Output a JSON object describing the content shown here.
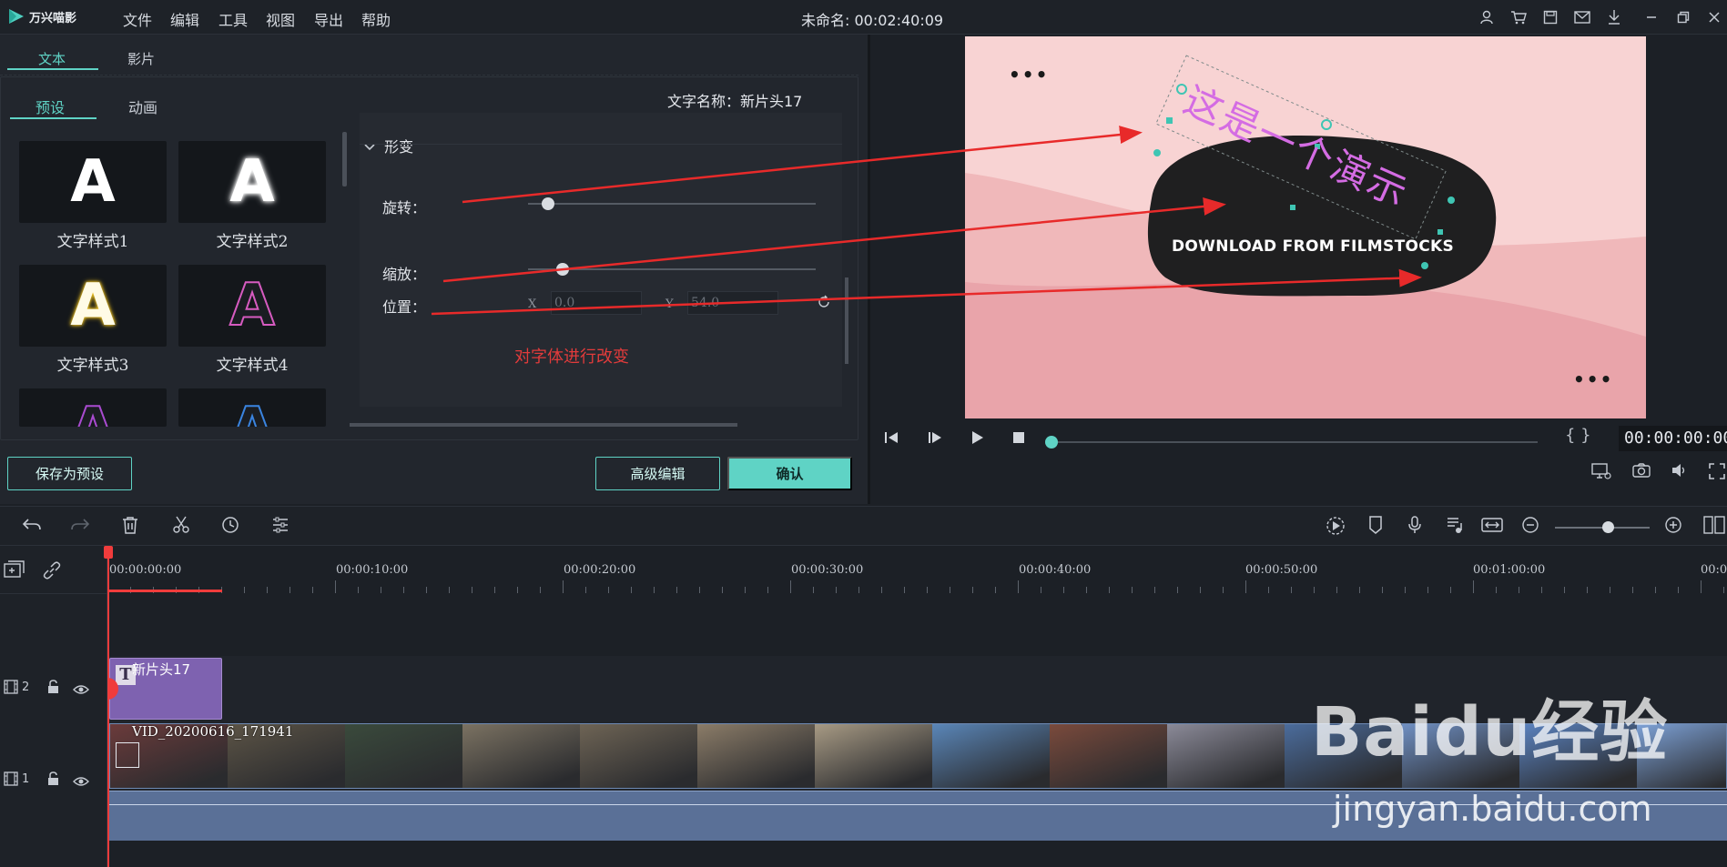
{
  "app": {
    "name": "万兴喵影",
    "document_title": "未命名: 00:02:40:09",
    "menu": [
      "文件",
      "编辑",
      "工具",
      "视图",
      "导出",
      "帮助"
    ],
    "window_icons": [
      "user-icon",
      "cart-icon",
      "save-icon",
      "mail-icon",
      "download-icon",
      "minimize-icon",
      "restore-icon",
      "close-icon"
    ]
  },
  "panel": {
    "top_tabs": [
      "文本",
      "影片"
    ],
    "sub_tabs": [
      "预设",
      "动画"
    ],
    "font_name_label": "文字名称：新片头17",
    "presets": [
      {
        "label": "文字样式1",
        "glyph": "A",
        "style": "white"
      },
      {
        "label": "文字样式2",
        "glyph": "A",
        "style": "white-glow"
      },
      {
        "label": "文字样式3",
        "glyph": "A",
        "style": "yellow-glow"
      },
      {
        "label": "文字样式4",
        "glyph": "A",
        "style": "pink-outline"
      },
      {
        "label": "",
        "glyph": "A",
        "style": "purple"
      },
      {
        "label": "",
        "glyph": "A",
        "style": "blue"
      }
    ],
    "transform": {
      "section_title": "形变",
      "rotate_label": "旋转：",
      "rotate_level": 0.07,
      "scale_label": "缩放：",
      "scale_level": 0.12,
      "position_label": "位置：",
      "x_axis": "X",
      "x_value": "0.0",
      "y_axis": "Y",
      "y_value": "54.0"
    },
    "annotation": "对字体进行改变",
    "buttons": {
      "save_preset": "保存为预设",
      "advanced_edit": "高级编辑",
      "confirm": "确认"
    }
  },
  "preview": {
    "title_text": "这是一个演示",
    "subtitle_text": "DOWNLOAD FROM FILMSTOCKS",
    "dots": "•••",
    "timecode": "00:00:00:00",
    "braces": "{ }",
    "progress": 0.0
  },
  "timeline": {
    "ruler_labels": [
      "00:00:00:00",
      "00:00:10:00",
      "00:00:20:00",
      "00:00:30:00",
      "00:00:40:00",
      "00:00:50:00",
      "00:01:00:00",
      "00:0"
    ],
    "tracks": [
      {
        "number": "2",
        "clip_label": "新片头17"
      },
      {
        "number": "1",
        "clip_label": "VID_20200616_171941"
      }
    ],
    "zoom_level": 0.56
  },
  "watermark": {
    "brand": "Baidu经验",
    "url": "jingyan.baidu.com"
  },
  "colors": {
    "accent": "#5fd3c5",
    "annotation_red": "#e23b3b",
    "title_clip": "#7e62b0",
    "audio_track": "#5a7097",
    "preview_bg": "#f8d3d3"
  }
}
